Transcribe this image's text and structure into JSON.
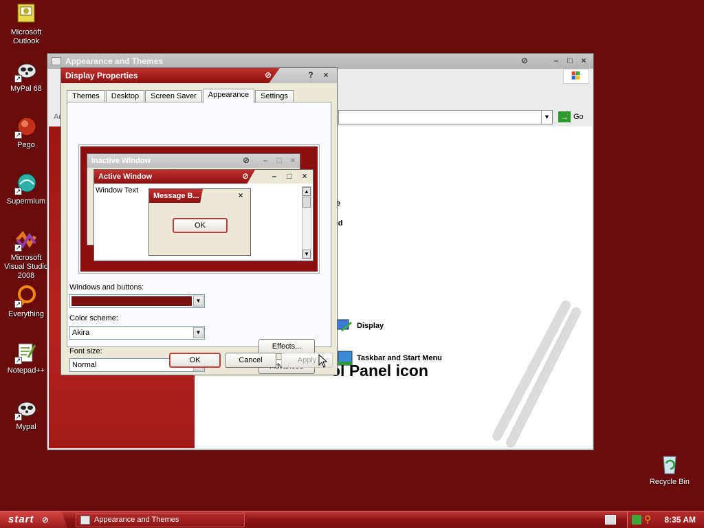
{
  "desktop": {
    "icons": [
      {
        "label": "Microsoft Outlook",
        "icon": "outlook-icon"
      },
      {
        "label": "MyPal 68",
        "icon": "mypal-icon"
      },
      {
        "label": "Pego",
        "icon": "pego-icon"
      },
      {
        "label": "Supermium",
        "icon": "supermium-icon"
      },
      {
        "label": "Microsoft Visual Studio 2008",
        "icon": "visual-studio-icon"
      },
      {
        "label": "Everything",
        "icon": "everything-icon"
      },
      {
        "label": "Notepad++",
        "icon": "notepad-plus-icon"
      },
      {
        "label": "Mypal",
        "icon": "mypal-icon"
      },
      {
        "label": "Recycle Bin",
        "icon": "recycle-bin-icon"
      }
    ]
  },
  "control_panel": {
    "title": "Appearance and Themes",
    "go_label": "Go",
    "heading": "ol Panel icon",
    "items": [
      {
        "label": "Display"
      },
      {
        "label": "Taskbar and Start Menu"
      }
    ],
    "fragments": {
      "left_cut": "Ad",
      "text1": "e",
      "text2": "nd"
    }
  },
  "display_properties": {
    "title": "Display Properties",
    "help": "?",
    "tabs": [
      "Themes",
      "Desktop",
      "Screen Saver",
      "Appearance",
      "Settings"
    ],
    "active_tab": "Appearance",
    "preview": {
      "inactive_title": "Inactive Window",
      "active_title": "Active Window",
      "window_text": "Window Text",
      "message_title": "Message B...",
      "ok": "OK"
    },
    "windows_buttons_label": "Windows and buttons:",
    "color_scheme_label": "Color scheme:",
    "color_scheme_value": "Akira",
    "font_size_label": "Font size:",
    "font_size_value": "Normal",
    "effects_button": "Effects...",
    "advanced_button": "Advanced",
    "ok_button": "OK",
    "cancel_button": "Cancel",
    "apply_button": "Apply"
  },
  "taskbar": {
    "start_label": "start",
    "task_label": "Appearance and Themes",
    "clock": "8:35 AM"
  },
  "colors": {
    "desktop": "#6b0a0a",
    "accent_red": "#a81c1c"
  }
}
